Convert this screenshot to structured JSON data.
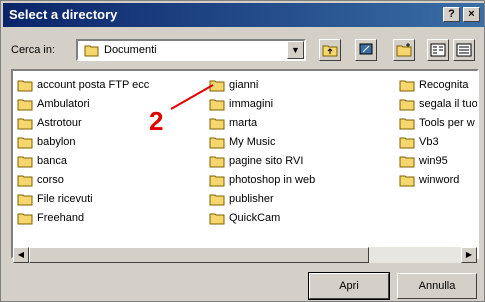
{
  "window": {
    "title": "Select a directory",
    "help_label": "?",
    "close_label": "×"
  },
  "toolbar": {
    "look_in_label": "Cerca in:",
    "look_in_value": "Documenti"
  },
  "folders": {
    "col1": [
      "account posta FTP ecc",
      "Ambulatori",
      "Astrotour",
      "babylon",
      "banca",
      "corso",
      "File ricevuti",
      "Freehand"
    ],
    "col2": [
      "gianni",
      "immagini",
      "marta",
      "My Music",
      "pagine sito RVI",
      "photoshop in web",
      "publisher",
      "QuickCam"
    ],
    "col3": [
      "Recognita",
      "segala il tuo",
      "Tools per w",
      "Vb3",
      "win95",
      "winword"
    ]
  },
  "buttons": {
    "open": "Apri",
    "cancel": "Annulla"
  },
  "annotation": {
    "number": "2"
  },
  "colors": {
    "title_start": "#0a246a",
    "title_end": "#3a6ea5",
    "annotation": "#e00000",
    "folder": "#f5d76e"
  }
}
